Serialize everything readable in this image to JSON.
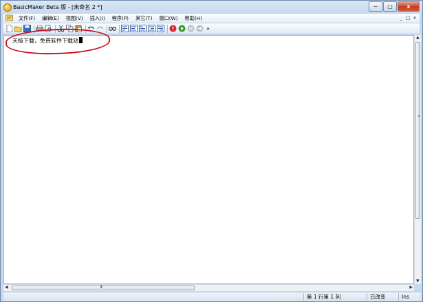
{
  "window": {
    "title": "BasicMaker Beta 版 - [未命名 2 *]",
    "caption_buttons": {
      "minimize": "─",
      "maximize": "□",
      "close": "x"
    }
  },
  "menubar": {
    "items": [
      "文件(F)",
      "编辑(E)",
      "视图(V)",
      "插入(I)",
      "程序(P)",
      "其它(T)",
      "窗口(W)",
      "帮助(H)"
    ],
    "mdi_buttons": {
      "minimize": "_",
      "restore": "□",
      "close": "x"
    }
  },
  "toolbar": {
    "buttons": [
      "new-icon",
      "open-icon",
      "save-icon",
      "print-icon",
      "print-preview-icon",
      "cut-icon",
      "copy-icon",
      "paste-icon",
      "undo-icon",
      "redo-icon",
      "find-icon",
      "debug-icon-1",
      "debug-icon-2",
      "debug-icon-3",
      "debug-icon-4",
      "debug-icon-5",
      "stop-icon",
      "run-icon",
      "pause-icon",
      "step-icon"
    ],
    "overflow": "»"
  },
  "editor": {
    "text": "天极下载，免费软件下载站"
  },
  "hscroll": {
    "grip": "⦀"
  },
  "statusbar": {
    "position": "第 1 行第 1 列",
    "modified": "已改变",
    "mode": "Ins"
  },
  "colors": {
    "highlight": "#c8141e",
    "run": "#3a9a2a",
    "stop": "#d8262a"
  }
}
